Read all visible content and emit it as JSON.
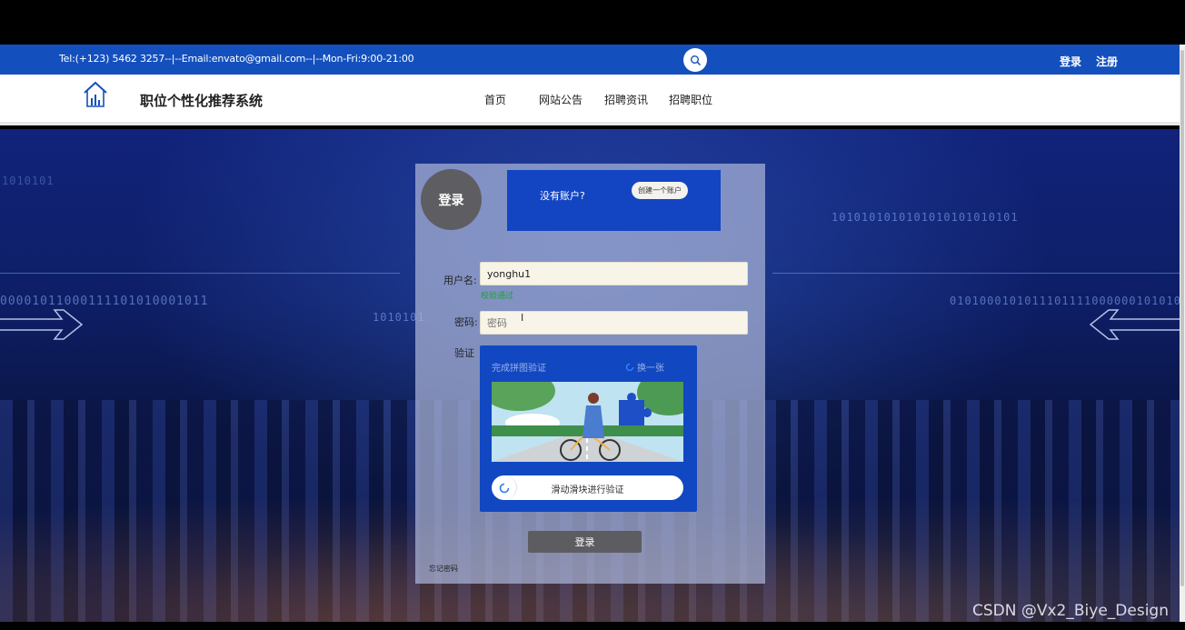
{
  "topbar": {
    "contact": "Tel:(+123) 5462 3257--|--Email:envato@gmail.com--|--Mon-Fri:9:00-21:00",
    "login": "登录",
    "register": "注册"
  },
  "navbar": {
    "site_title": "职位个性化推荐系统",
    "items": [
      {
        "label": "首页"
      },
      {
        "label": "网站公告"
      },
      {
        "label": "招聘资讯"
      },
      {
        "label": "招聘职位"
      }
    ]
  },
  "hero": {
    "binary_left": "00001011000111101010001011",
    "binary_left_top": "1010101",
    "binary_mid": "1010101",
    "binary_right_top": "1010101010101010101010101",
    "binary_right": "0101000101011101111000000101010000"
  },
  "login": {
    "title": "登录",
    "no_account": "没有账户?",
    "create_account": "创建一个账户",
    "username_label": "用户名:",
    "username_value": "yonghu1",
    "username_hint": "校验通过",
    "password_label": "密码:",
    "password_placeholder": "密码",
    "captcha_label": "验证",
    "captcha_title": "完成拼图验证",
    "captcha_refresh": "换一张",
    "slider_text": "滑动滑块进行验证",
    "submit": "登录",
    "forgot": "忘记密码"
  },
  "watermark": "CSDN @Vx2_Biye_Design",
  "icons": [
    "search-icon",
    "home-chart-logo-icon",
    "refresh-icon",
    "slider-refresh-icon",
    "arrow-left-icon",
    "arrow-right-icon"
  ],
  "colors": {
    "topbar": "#1450bd",
    "signup_box": "#1345c3",
    "captcha_box": "#1247c2",
    "button_gray": "#5d5d61",
    "input_bg": "#f8f4e7",
    "success_green": "#1f9d3a"
  }
}
